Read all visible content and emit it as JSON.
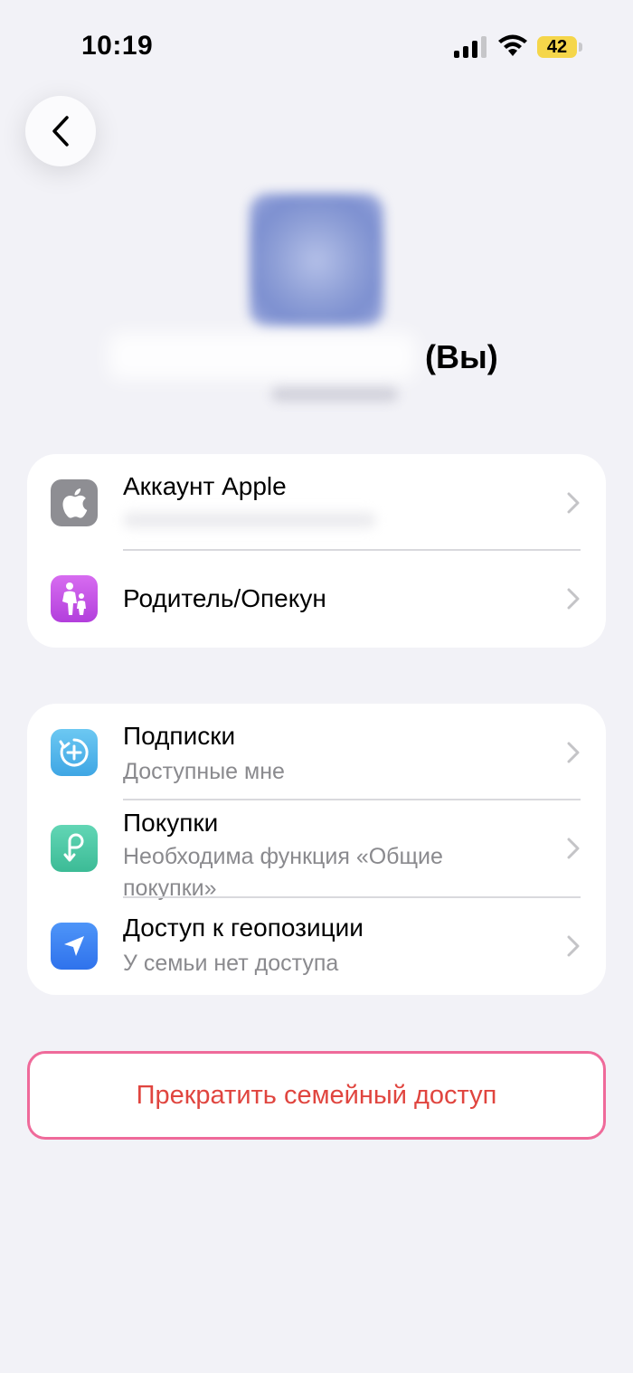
{
  "status_bar": {
    "time": "10:19",
    "battery": "42",
    "battery_color": "#f5d64a"
  },
  "profile": {
    "you_label": "(Вы)"
  },
  "section1": {
    "items": [
      {
        "title": "Аккаунт Apple",
        "icon": "apple-logo-icon",
        "icon_bg": "#8e8e93"
      },
      {
        "title": "Родитель/Опекун",
        "icon": "parent-child-icon",
        "icon_bg": "#c04fe0"
      }
    ]
  },
  "section2": {
    "items": [
      {
        "title": "Подписки",
        "subtitle": "Доступные мне",
        "icon": "subscriptions-plus-icon",
        "icon_bg": "#5ab6ea"
      },
      {
        "title": "Покупки",
        "subtitle": "Необходима функция «Общие покупки»",
        "icon": "purchases-p-icon",
        "icon_bg": "#4ec9a6"
      },
      {
        "title": "Доступ к геопозиции",
        "subtitle": "У семьи нет доступа",
        "icon": "location-arrow-icon",
        "icon_bg": "#3f86f5"
      }
    ]
  },
  "stop_button": {
    "label": "Прекратить семейный доступ",
    "color": "#e0453f",
    "highlight_color": "#ef6a9a"
  }
}
